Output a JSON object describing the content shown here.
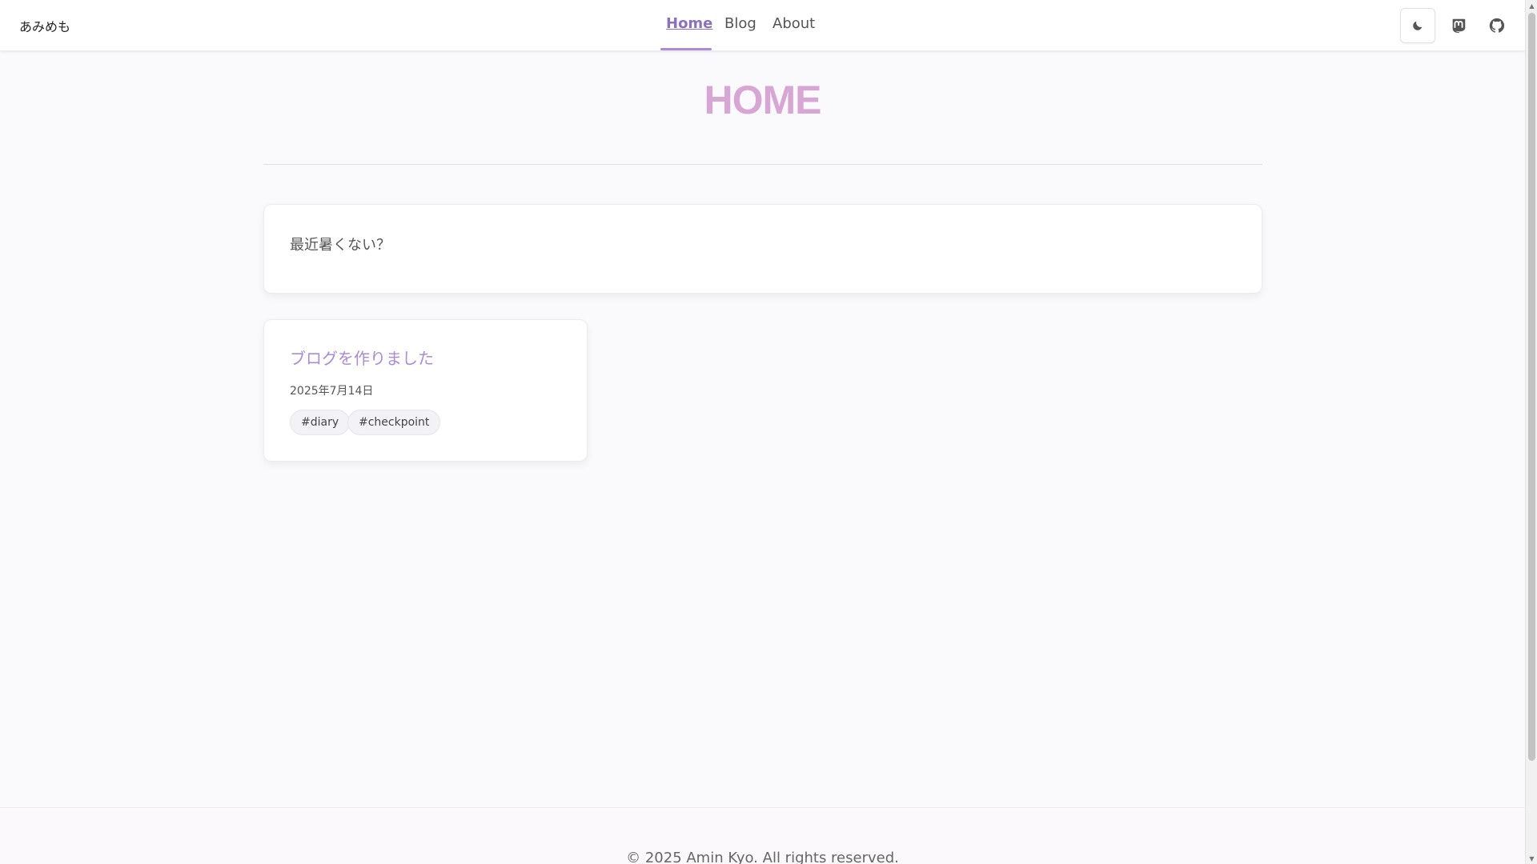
{
  "header": {
    "site_title": "あみめも",
    "nav": [
      {
        "label": "Home",
        "active": true
      },
      {
        "label": "Blog",
        "active": false
      },
      {
        "label": "About",
        "active": false
      }
    ],
    "icons": [
      "moon-icon",
      "mastodon-icon",
      "github-icon"
    ]
  },
  "main": {
    "heading": "HOME",
    "announcement": "最近暑くない？",
    "posts": [
      {
        "title": "ブログを作りました",
        "date": "2025年7月14日",
        "tags": [
          "#diary",
          "#checkpoint"
        ]
      }
    ]
  },
  "footer": {
    "copyright": "© 2025 Amin Kyo. All rights reserved."
  },
  "colors": {
    "accent": "#a98bd6",
    "heading": "#d8a6d4",
    "background": "#fafafc"
  }
}
